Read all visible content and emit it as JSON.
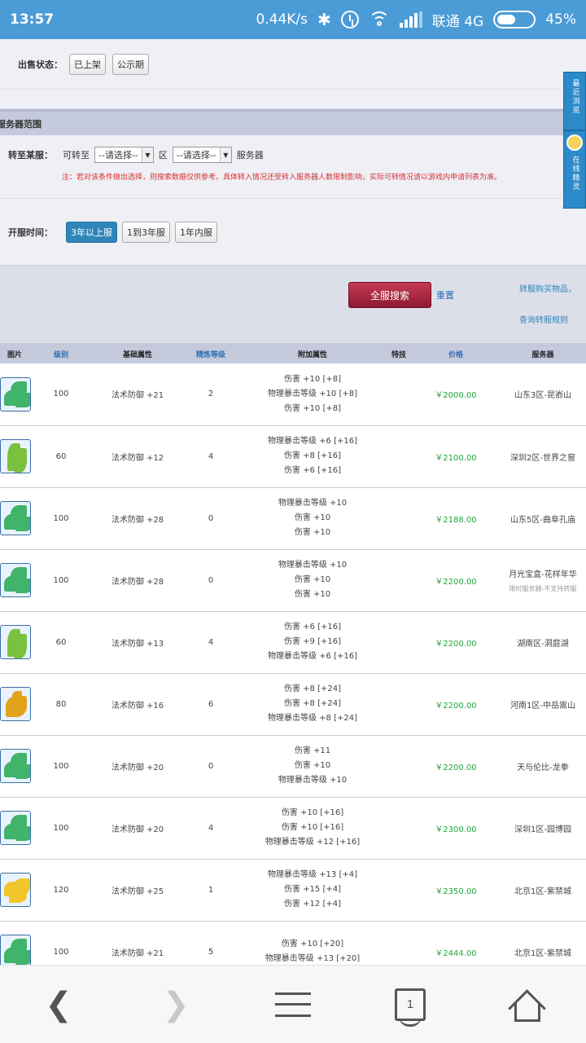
{
  "status_bar": {
    "time": "13:57",
    "speed": "0.44K/s",
    "carrier": "联通 4G",
    "battery": "45%"
  },
  "filters": {
    "sale_status_label": "出售状态：",
    "sale_status_options": [
      "已上架",
      "公示期"
    ],
    "server_range_title": "服务器范围",
    "transfer_label": "转至某服：",
    "transfer_prefix": "可转至",
    "select_placeholder_1": "--请选择--",
    "zone_label": "区",
    "select_placeholder_2": "--请选择--",
    "server_suffix": "服务器",
    "note": "注：若对该条件做出选择，则搜索数据仅供参考。具体转入情况还受转入服务器人数限制影响，实际可转情况请以游戏内申请列表为准。",
    "open_time_label": "开服时间：",
    "open_time_options": [
      "3年以上服",
      "1到3年服",
      "1年内服"
    ],
    "open_time_active": "3年以上服"
  },
  "search": {
    "button": "全服搜索",
    "reset": "重置",
    "link_transfer": "转服购买物品，",
    "link_rules": "查询转服规则"
  },
  "side_tabs": {
    "recent": "最近浏览",
    "online": "在线精灵"
  },
  "table": {
    "headers": [
      "图片",
      "级别",
      "基础属性",
      "精炼等级",
      "附加属性",
      "特技",
      "价格",
      "服务器"
    ],
    "rows": [
      {
        "img": "green",
        "level": "100",
        "base": "法术防御 +21",
        "refine": "2",
        "attrs": [
          "伤害 +10 [+8]",
          "物理暴击等级 +10 [+8]",
          "伤害 +10 [+8]"
        ],
        "price": "￥2000.00",
        "server": "山东3区-昆嵛山",
        "note": ""
      },
      {
        "img": "leaf",
        "level": "60",
        "base": "法术防御 +12",
        "refine": "4",
        "attrs": [
          "物理暴击等级 +6 [+16]",
          "伤害 +8 [+16]",
          "伤害 +6 [+16]"
        ],
        "price": "￥2100.00",
        "server": "深圳2区-世界之窗",
        "note": ""
      },
      {
        "img": "green",
        "level": "100",
        "base": "法术防御 +28",
        "refine": "0",
        "attrs": [
          "物理暴击等级 +10",
          "伤害 +10",
          "伤害 +10"
        ],
        "price": "￥2188.00",
        "server": "山东5区-曲阜孔庙",
        "note": ""
      },
      {
        "img": "green",
        "level": "100",
        "base": "法术防御 +28",
        "refine": "0",
        "attrs": [
          "物理暴击等级 +10",
          "伤害 +10",
          "伤害 +10"
        ],
        "price": "￥2200.00",
        "server": "月光宝盒-花样年华",
        "note": "限时服务器-不支持转服"
      },
      {
        "img": "leaf",
        "level": "60",
        "base": "法术防御 +13",
        "refine": "4",
        "attrs": [
          "伤害 +6 [+16]",
          "伤害 +9 [+16]",
          "物理暴击等级 +6 [+16]"
        ],
        "price": "￥2200.00",
        "server": "湖南区-洞庭湖",
        "note": ""
      },
      {
        "img": "gold",
        "level": "80",
        "base": "法术防御 +16",
        "refine": "6",
        "attrs": [
          "伤害 +8 [+24]",
          "伤害 +8 [+24]",
          "物理暴击等级 +8 [+24]"
        ],
        "price": "￥2200.00",
        "server": "河南1区-中岳嵩山",
        "note": ""
      },
      {
        "img": "green",
        "level": "100",
        "base": "法术防御 +20",
        "refine": "0",
        "attrs": [
          "伤害 +11",
          "伤害 +10",
          "物理暴击等级 +10"
        ],
        "price": "￥2200.00",
        "server": "天与伦比-龙拳",
        "note": ""
      },
      {
        "img": "green",
        "level": "100",
        "base": "法术防御 +20",
        "refine": "4",
        "attrs": [
          "伤害 +10 [+16]",
          "伤害 +10 [+16]",
          "物理暴击等级 +12 [+16]"
        ],
        "price": "￥2300.00",
        "server": "深圳1区-园博园",
        "note": ""
      },
      {
        "img": "yellow",
        "level": "120",
        "base": "法术防御 +25",
        "refine": "1",
        "attrs": [
          "物理暴击等级 +13 [+4]",
          "伤害 +15 [+4]",
          "伤害 +12 [+4]"
        ],
        "price": "￥2350.00",
        "server": "北京1区-紫禁城",
        "note": ""
      },
      {
        "img": "green",
        "level": "100",
        "base": "法术防御 +21",
        "refine": "5",
        "attrs": [
          "伤害 +10 [+20]",
          "物理暴击等级 +13 [+20]",
          ""
        ],
        "price": "￥2444.00",
        "server": "北京1区-紫禁城",
        "note": ""
      }
    ]
  },
  "nav": {
    "tab_count": "1"
  }
}
